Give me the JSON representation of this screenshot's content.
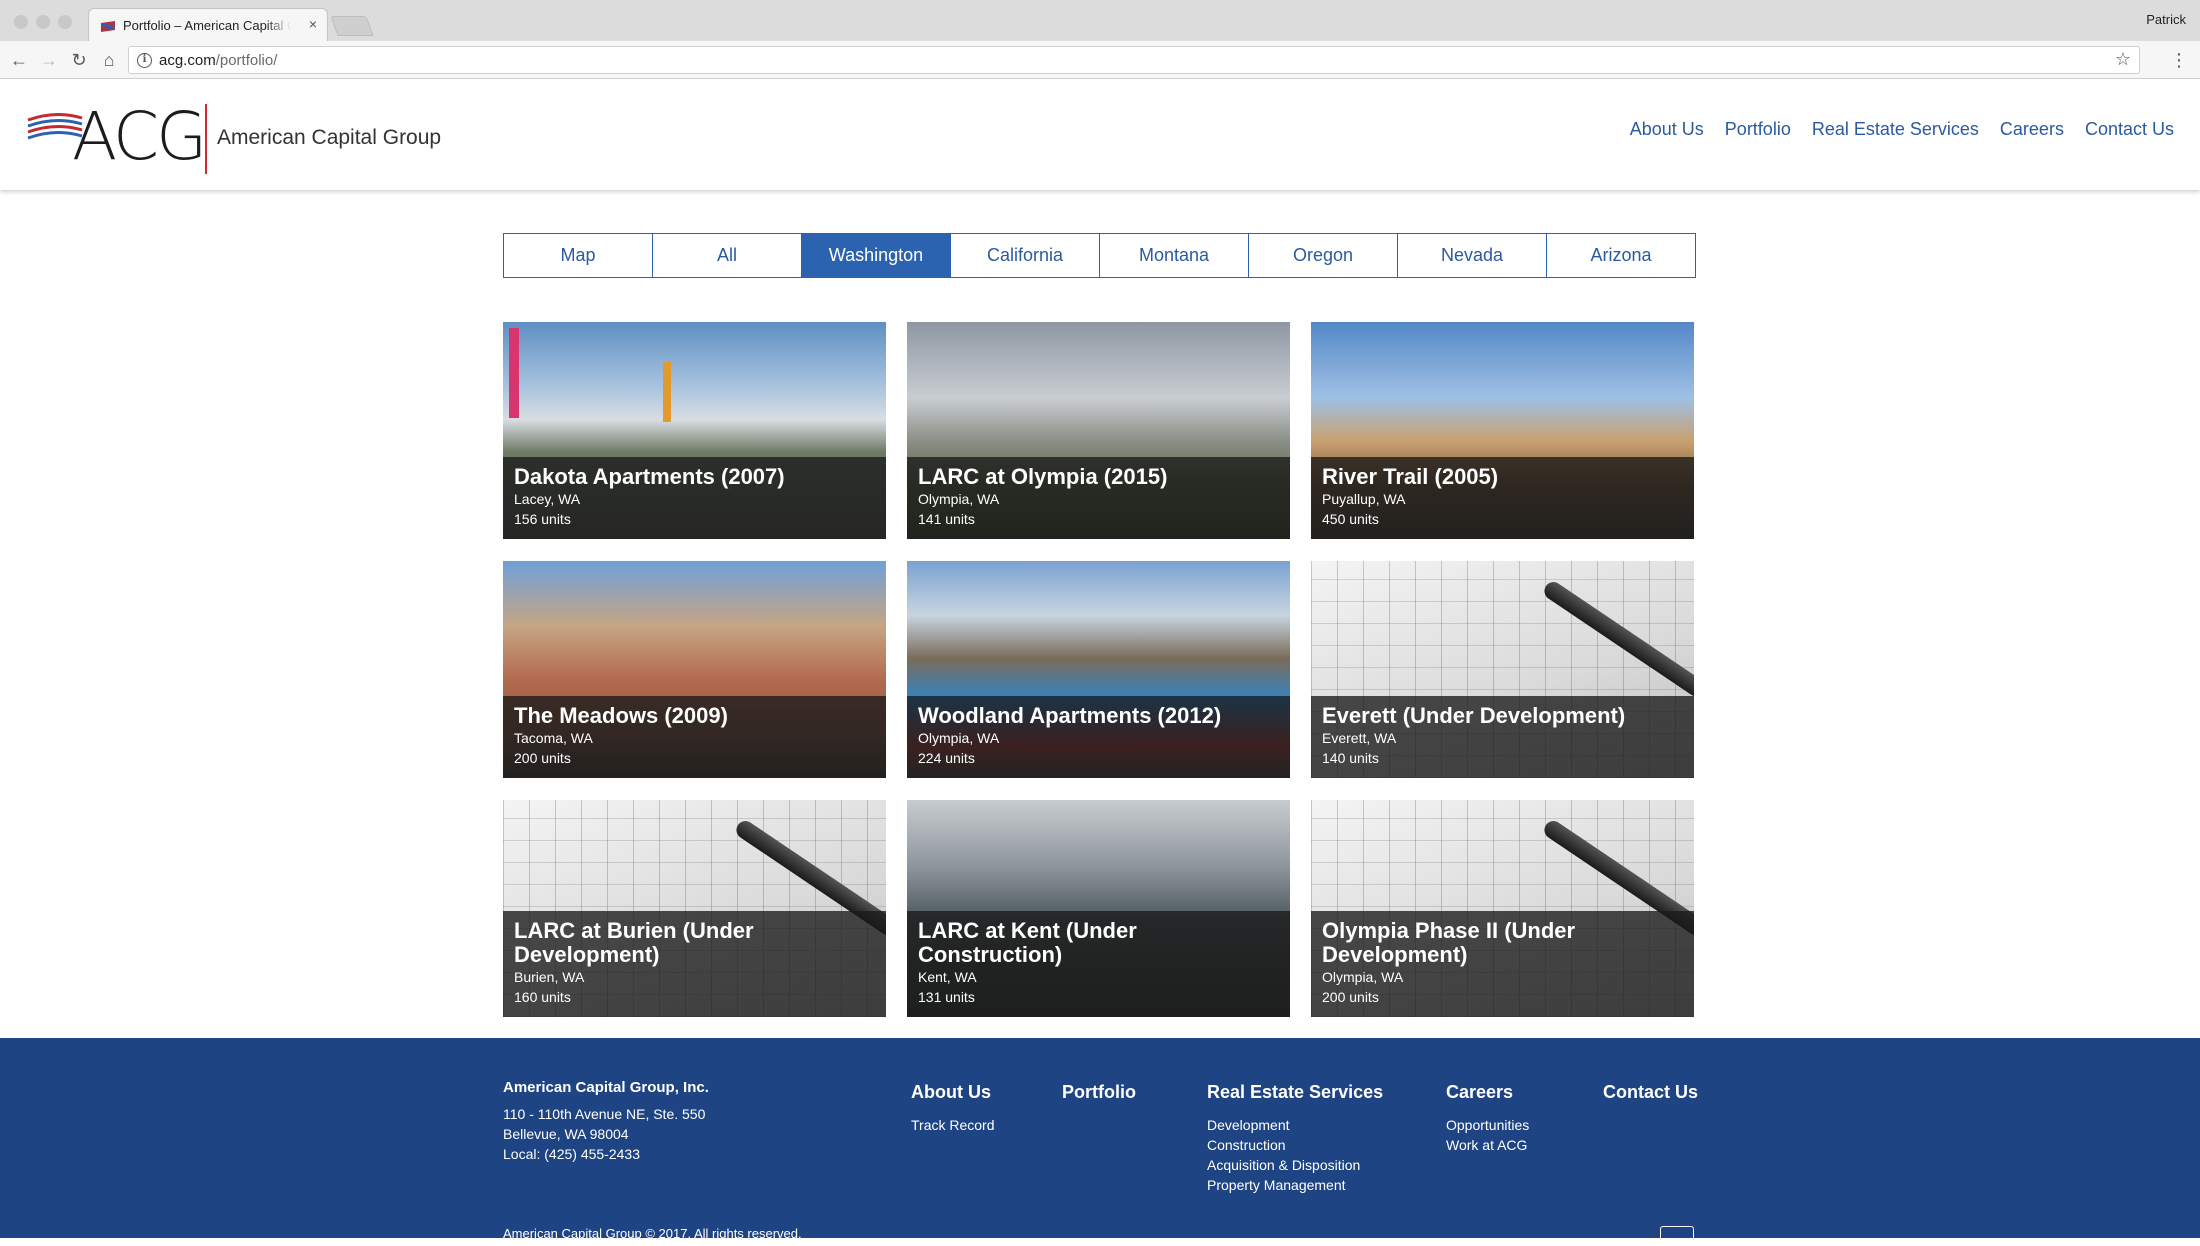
{
  "browser": {
    "tab_title": "Portfolio – American Capital Group",
    "tab_close": "×",
    "profile": "Patrick",
    "url_host": "acg.com",
    "url_path": "/portfolio/",
    "icons": [
      "back-icon",
      "forward-icon",
      "reload-icon",
      "home-icon",
      "info-icon",
      "star-icon",
      "menu-icon"
    ]
  },
  "header": {
    "logo_text": "ACG",
    "company_name": "American Capital Group",
    "nav": [
      "About Us",
      "Portfolio",
      "Real Estate Services",
      "Careers",
      "Contact Us"
    ]
  },
  "filters": {
    "items": [
      "Map",
      "All",
      "Washington",
      "California",
      "Montana",
      "Oregon",
      "Nevada",
      "Arizona"
    ],
    "active": "Washington",
    "active_color": "#2b63b0"
  },
  "properties": [
    {
      "title": "Dakota Apartments (2007)",
      "location": "Lacey, WA",
      "units": "156 units"
    },
    {
      "title": "LARC at Olympia (2015)",
      "location": "Olympia, WA",
      "units": "141 units"
    },
    {
      "title": "River Trail (2005)",
      "location": "Puyallup, WA",
      "units": "450 units"
    },
    {
      "title": "The Meadows (2009)",
      "location": "Tacoma, WA",
      "units": "200 units"
    },
    {
      "title": "Woodland Apartments (2012)",
      "location": "Olympia, WA",
      "units": "224 units"
    },
    {
      "title": "Everett (Under Development)",
      "location": "Everett, WA",
      "units": "140 units"
    },
    {
      "title": "LARC at Burien (Under Development)",
      "location": "Burien, WA",
      "units": "160 units"
    },
    {
      "title": "LARC at Kent (Under Construction)",
      "location": "Kent, WA",
      "units": "131 units"
    },
    {
      "title": "Olympia Phase II (Under Development)",
      "location": "Olympia, WA",
      "units": "200 units"
    }
  ],
  "footer": {
    "company": "American Capital Group, Inc.",
    "address1": "110 - 110th Avenue NE, Ste. 550",
    "address2": "Bellevue, WA 98004",
    "phone": "Local: (425) 455-2433",
    "columns": [
      {
        "head": "About Us",
        "links": [
          "Track Record"
        ]
      },
      {
        "head": "Portfolio",
        "links": []
      },
      {
        "head": "Real Estate Services",
        "links": [
          "Development",
          "Construction",
          "Acquisition & Disposition",
          "Property Management"
        ]
      },
      {
        "head": "Careers",
        "links": [
          "Opportunities",
          "Work at ACG"
        ]
      },
      {
        "head": "Contact Us",
        "links": []
      }
    ],
    "copyright": "American Capital Group © 2017. All rights reserved.",
    "background": "#1f4483"
  }
}
